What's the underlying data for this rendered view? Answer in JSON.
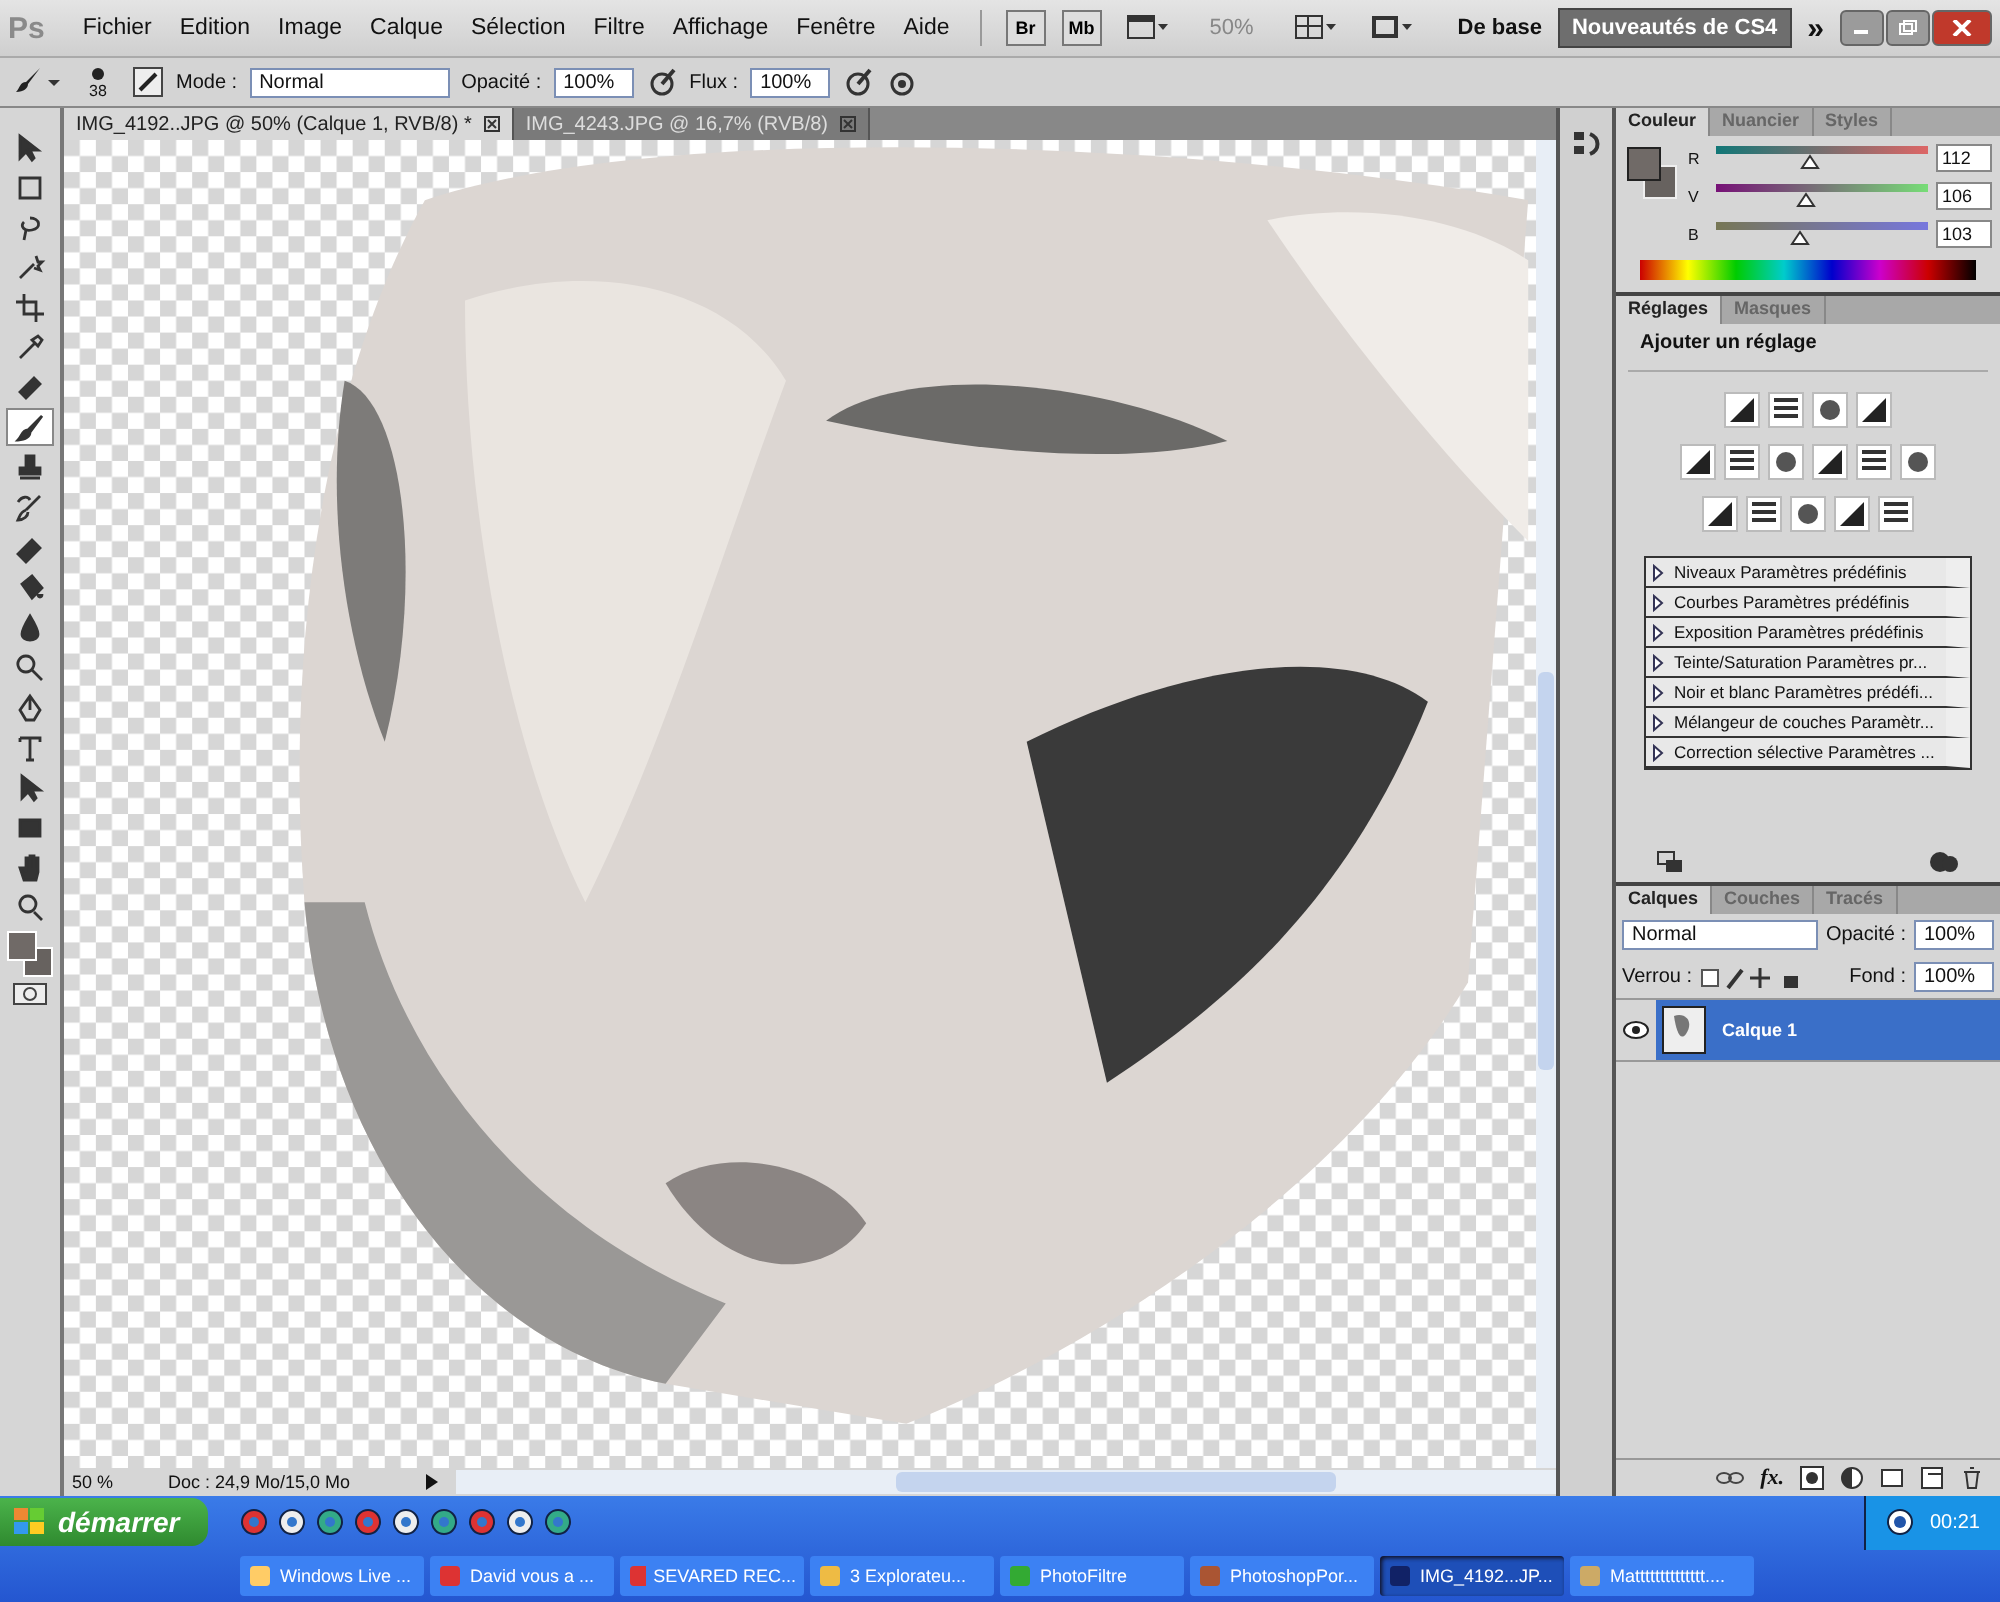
{
  "menu_bar": {
    "logo": "Ps",
    "items": [
      "Fichier",
      "Edition",
      "Image",
      "Calque",
      "Sélection",
      "Filtre",
      "Affichage",
      "Fenêtre",
      "Aide"
    ],
    "br": "Br",
    "mb": "Mb",
    "zoom": "50%",
    "workspace": "De base",
    "cs4_button": "Nouveautés de CS4",
    "more": "»"
  },
  "options_bar": {
    "brush_size": "38",
    "mode_label": "Mode :",
    "mode": "Normal",
    "opacity_label": "Opacité :",
    "opacity": "100%",
    "flow_label": "Flux :",
    "flow": "100%"
  },
  "document_tabs": [
    {
      "label": "IMG_4192..JPG @ 50% (Calque 1, RVB/8) *",
      "selected": true
    },
    {
      "label": "IMG_4243.JPG @ 16,7% (RVB/8)",
      "selected": false
    }
  ],
  "toolbox": [
    {
      "kind": "move",
      "selected": false
    },
    {
      "kind": "marquee",
      "selected": false
    },
    {
      "kind": "lasso",
      "selected": false
    },
    {
      "kind": "wand",
      "selected": false
    },
    {
      "kind": "crop",
      "selected": false
    },
    {
      "kind": "dropper",
      "selected": false
    },
    {
      "kind": "heal",
      "selected": false
    },
    {
      "kind": "brush",
      "selected": true
    },
    {
      "kind": "stamp",
      "selected": false
    },
    {
      "kind": "history",
      "selected": false
    },
    {
      "kind": "eraser",
      "selected": false
    },
    {
      "kind": "bucket",
      "selected": false
    },
    {
      "kind": "drop",
      "selected": false
    },
    {
      "kind": "dodge",
      "selected": false
    },
    {
      "kind": "pen",
      "selected": false
    },
    {
      "kind": "type",
      "selected": false
    },
    {
      "kind": "select",
      "selected": false
    },
    {
      "kind": "shape",
      "selected": false
    },
    {
      "kind": "hand",
      "selected": false
    },
    {
      "kind": "zoom",
      "selected": false
    }
  ],
  "status_bar": {
    "zoom": "50 %",
    "doc": "Doc : 24,9 Mo/15,0 Mo"
  },
  "color_panel": {
    "tabs": [
      {
        "label": "Couleur",
        "selected": true
      },
      {
        "label": "Nuancier",
        "selected": false
      },
      {
        "label": "Styles",
        "selected": false
      }
    ],
    "channels": [
      {
        "label": "R",
        "level": 0.44,
        "value": "112"
      },
      {
        "label": "V",
        "level": 0.42,
        "value": "106"
      },
      {
        "label": "B",
        "level": 0.4,
        "value": "103"
      }
    ]
  },
  "adjustments_panel": {
    "tabs": [
      {
        "label": "Réglages",
        "selected": true
      },
      {
        "label": "Masques",
        "selected": false
      }
    ],
    "heading": "Ajouter un réglage",
    "presets": [
      "Niveaux Paramètres prédéfinis",
      "Courbes Paramètres prédéfinis",
      "Exposition Paramètres prédéfinis",
      "Teinte/Saturation Paramètres pr...",
      "Noir et blanc Paramètres prédéfi...",
      "Mélangeur de couches Paramètr...",
      "Correction sélective Paramètres ..."
    ]
  },
  "layers_panel": {
    "tabs": [
      {
        "label": "Calques",
        "selected": true
      },
      {
        "label": "Couches",
        "selected": false
      },
      {
        "label": "Tracés",
        "selected": false
      }
    ],
    "blend_mode": "Normal",
    "opacity_label": "Opacité :",
    "opacity": "100%",
    "lock_label": "Verrou :",
    "fill_label": "Fond :",
    "fill": "100%",
    "layers": [
      {
        "name": "Calque 1",
        "selected": true,
        "visible": true
      }
    ],
    "fx": "fx."
  },
  "taskbar": {
    "start": "démarrer",
    "time": "00:21",
    "tasks": [
      {
        "label": "Windows Live ...",
        "selected": false
      },
      {
        "label": "David vous a ...",
        "selected": false
      },
      {
        "label": "SEVARED REC...",
        "selected": false
      },
      {
        "label": "3 Explorateu...",
        "selected": false
      },
      {
        "label": "PhotoFiltre",
        "selected": false
      },
      {
        "label": "PhotoshopPor...",
        "selected": false
      },
      {
        "label": "IMG_4192...JP...",
        "selected": true
      },
      {
        "label": "Matttttttttttttt....",
        "selected": false
      }
    ]
  }
}
